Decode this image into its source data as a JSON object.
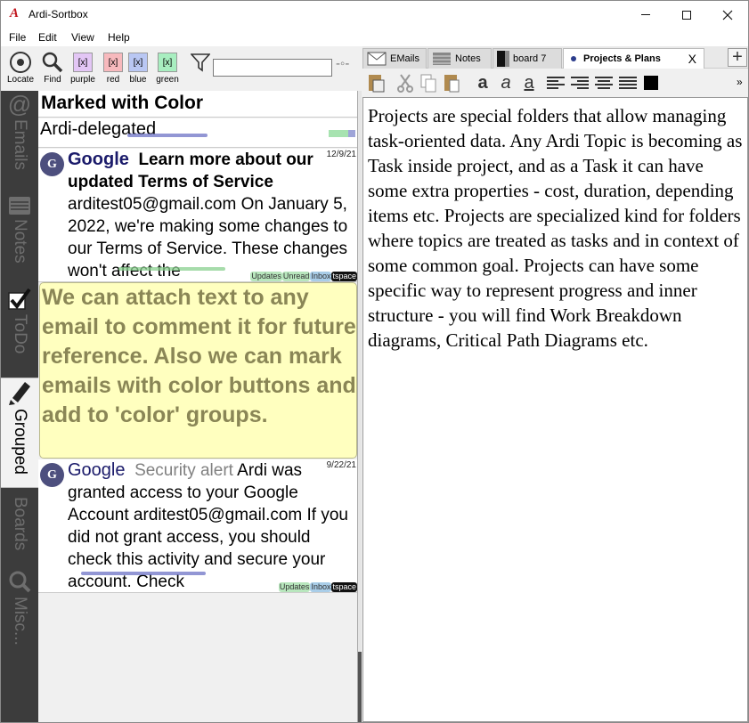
{
  "window": {
    "title": "Ardi-Sortbox"
  },
  "menu": [
    "File",
    "Edit",
    "View",
    "Help"
  ],
  "toolbar": {
    "locate": "Locate",
    "find": "Find",
    "colors": [
      {
        "label": "purple",
        "glyph": "[x]",
        "color": "#e3c6f5"
      },
      {
        "label": "red",
        "glyph": "[x]",
        "color": "#f7b9bd"
      },
      {
        "label": "blue",
        "glyph": "[x]",
        "color": "#b9c7f3"
      },
      {
        "label": "green",
        "glyph": "[x]",
        "color": "#a8eec0"
      }
    ],
    "filter_value": ""
  },
  "side_tabs": [
    {
      "label": "Emails",
      "icon": "at-icon"
    },
    {
      "label": "Notes",
      "icon": "notes-icon"
    },
    {
      "label": "ToDo",
      "icon": "checkmark-icon"
    },
    {
      "label": "Grouped",
      "icon": "marker-icon",
      "active": true
    },
    {
      "label": "Boards",
      "icon": "boards-icon"
    },
    {
      "label": "Misc...",
      "icon": "search-icon"
    }
  ],
  "list": {
    "header": "Marked with Color",
    "subgroup": "Ardi-delegated",
    "items": [
      {
        "avatar": "G",
        "sender": "Google",
        "subject": "Learn more about our updated Terms of Service",
        "body": "arditest05@gmail.com On January 5, 2022, we're making some changes to our Terms of Service. These changes won't affect the",
        "date": "12/9/21",
        "tags": [
          "Updates",
          "Unread",
          "Inbox",
          "tspace"
        ]
      },
      {
        "avatar": "G",
        "sender": "Google",
        "subject": "Security alert",
        "body": "Ardi was granted access to your Google Account arditest05@gmail.com If you did not grant access, you should check this activity and secure your account. Check",
        "date": "9/22/21",
        "tags": [
          "Updates",
          "Inbox",
          "tspace"
        ]
      }
    ],
    "note": "We can attach text to any email to comment it for future reference. Also we can mark emails with color buttons and add to 'color' groups."
  },
  "tabs": [
    {
      "label": "EMails",
      "icon": "envelope-icon"
    },
    {
      "label": "Notes",
      "icon": "notes-icon"
    },
    {
      "label": "board 7",
      "icon": "board-icon"
    },
    {
      "label": "Projects & Plans",
      "active": true,
      "close": "X"
    }
  ],
  "editor": {
    "text": "Projects are special folders that allow managing task-oriented data. Any Ardi Topic is becoming as Task inside project, and as a Task it can have some extra properties - cost, duration, depending items etc. Projects are specialized kind for folders where topics are treated as tasks and in context of some common goal. Projects can have some specific way to represent progress and inner structure - you will find Work Breakdown diagrams, Critical Path Diagrams etc."
  },
  "more_glyph": "»"
}
